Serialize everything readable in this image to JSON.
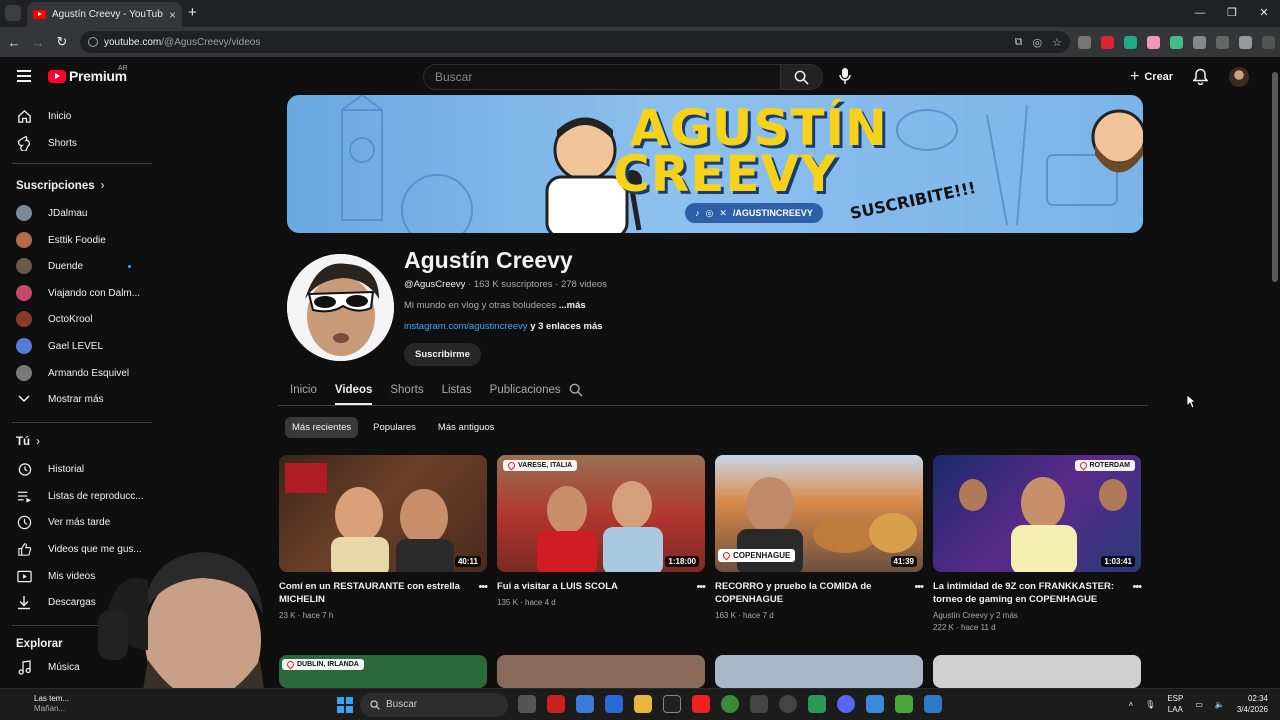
{
  "browser": {
    "tab_title": "Agustín Creevy - YouTube",
    "url_domain": "youtube.com",
    "url_path": "/@AgusCreevy/videos"
  },
  "header": {
    "logo_text": "Premium",
    "country_code": "AR",
    "search_placeholder": "Buscar",
    "create_label": "Crear"
  },
  "sidebar": {
    "main": [
      {
        "label": "Inicio",
        "icon": "home-icon"
      },
      {
        "label": "Shorts",
        "icon": "shorts-icon"
      }
    ],
    "subscriptions_title": "Suscripciones",
    "subscriptions": [
      {
        "label": "JDalmau",
        "color": "#7a8a9a"
      },
      {
        "label": "Esttik Foodie",
        "color": "#b06a4a"
      },
      {
        "label": "Duende",
        "color": "#6a5a4a",
        "new": true
      },
      {
        "label": "Viajando con Dalm...",
        "color": "#c44a6a"
      },
      {
        "label": "OctoKrool",
        "color": "#8a3a2a"
      },
      {
        "label": "Gael LEVEL",
        "color": "#5a7ad8"
      },
      {
        "label": "Armando Esquivel",
        "color": "#7a7a7a"
      }
    ],
    "show_more": "Mostrar más",
    "you_title": "Tú",
    "you_items": [
      {
        "label": "Historial",
        "icon": "history-icon"
      },
      {
        "label": "Listas de reproducc...",
        "icon": "playlists-icon"
      },
      {
        "label": "Ver más tarde",
        "icon": "watch-later-icon"
      },
      {
        "label": "Videos que me gus...",
        "icon": "like-icon"
      },
      {
        "label": "Mis videos",
        "icon": "my-videos-icon"
      },
      {
        "label": "Descargas",
        "icon": "download-icon"
      }
    ],
    "explore_title": "Explorar",
    "explore_items": [
      {
        "label": "Música",
        "icon": "music-icon"
      }
    ]
  },
  "banner": {
    "line1": "AGUSTÍN",
    "line2": "CREEVY",
    "handle": "/AGUSTINCREEVY",
    "cta": "SUSCRIBITE!!!",
    "colors": {
      "bg": "#7ab4e8",
      "text": "#f7d21a"
    }
  },
  "channel": {
    "name": "Agustín Creevy",
    "handle": "@AgusCreevy",
    "stats": "· 163 K suscriptores · 278 videos",
    "description": "Mi mundo en vlog y otras boludeces",
    "description_more": "...más",
    "link": "instagram.com/agustincreevy",
    "link_more": "y 3 enlaces más",
    "subscribe_label": "Suscribirme"
  },
  "tabs": [
    "Inicio",
    "Videos",
    "Shorts",
    "Listas",
    "Publicaciones"
  ],
  "active_tab": "Videos",
  "chips": [
    "Más recientes",
    "Populares",
    "Más antiguos"
  ],
  "videos": [
    {
      "title": "Comí en un RESTAURANTE con estrella MICHELIN",
      "views": "23 K",
      "age": "hace 7 h",
      "duration": "40:11",
      "author": "",
      "location": ""
    },
    {
      "title": "Fui a visitar a LUIS SCOLA",
      "views": "135 K",
      "age": "hace 4 d",
      "duration": "1:18:00",
      "author": "",
      "location": "VARESE, ITALIA"
    },
    {
      "title": "RECORRO y pruebo la COMIDA de COPENHAGUE",
      "views": "163 K",
      "age": "hace 7 d",
      "duration": "41:39",
      "author": "",
      "location": "COPENHAGUE"
    },
    {
      "title": "La intimidad de 9Z con FRANKKASTER: torneo de gaming en COPENHAGUE",
      "views": "222 K",
      "age": "hace 11 d",
      "duration": "1:03:41",
      "author": "Agustín Creevy y 2 más",
      "location": "ROTERDAM"
    }
  ],
  "next_row": [
    {
      "location": "DUBLIN, IRLANDA"
    }
  ],
  "taskbar": {
    "weather_title": "Las tem...",
    "weather_sub": "Mañan...",
    "search_label": "Buscar",
    "lang1": "ESP",
    "lang2": "LAA",
    "time": "02:34",
    "date": "3/4/2026"
  }
}
